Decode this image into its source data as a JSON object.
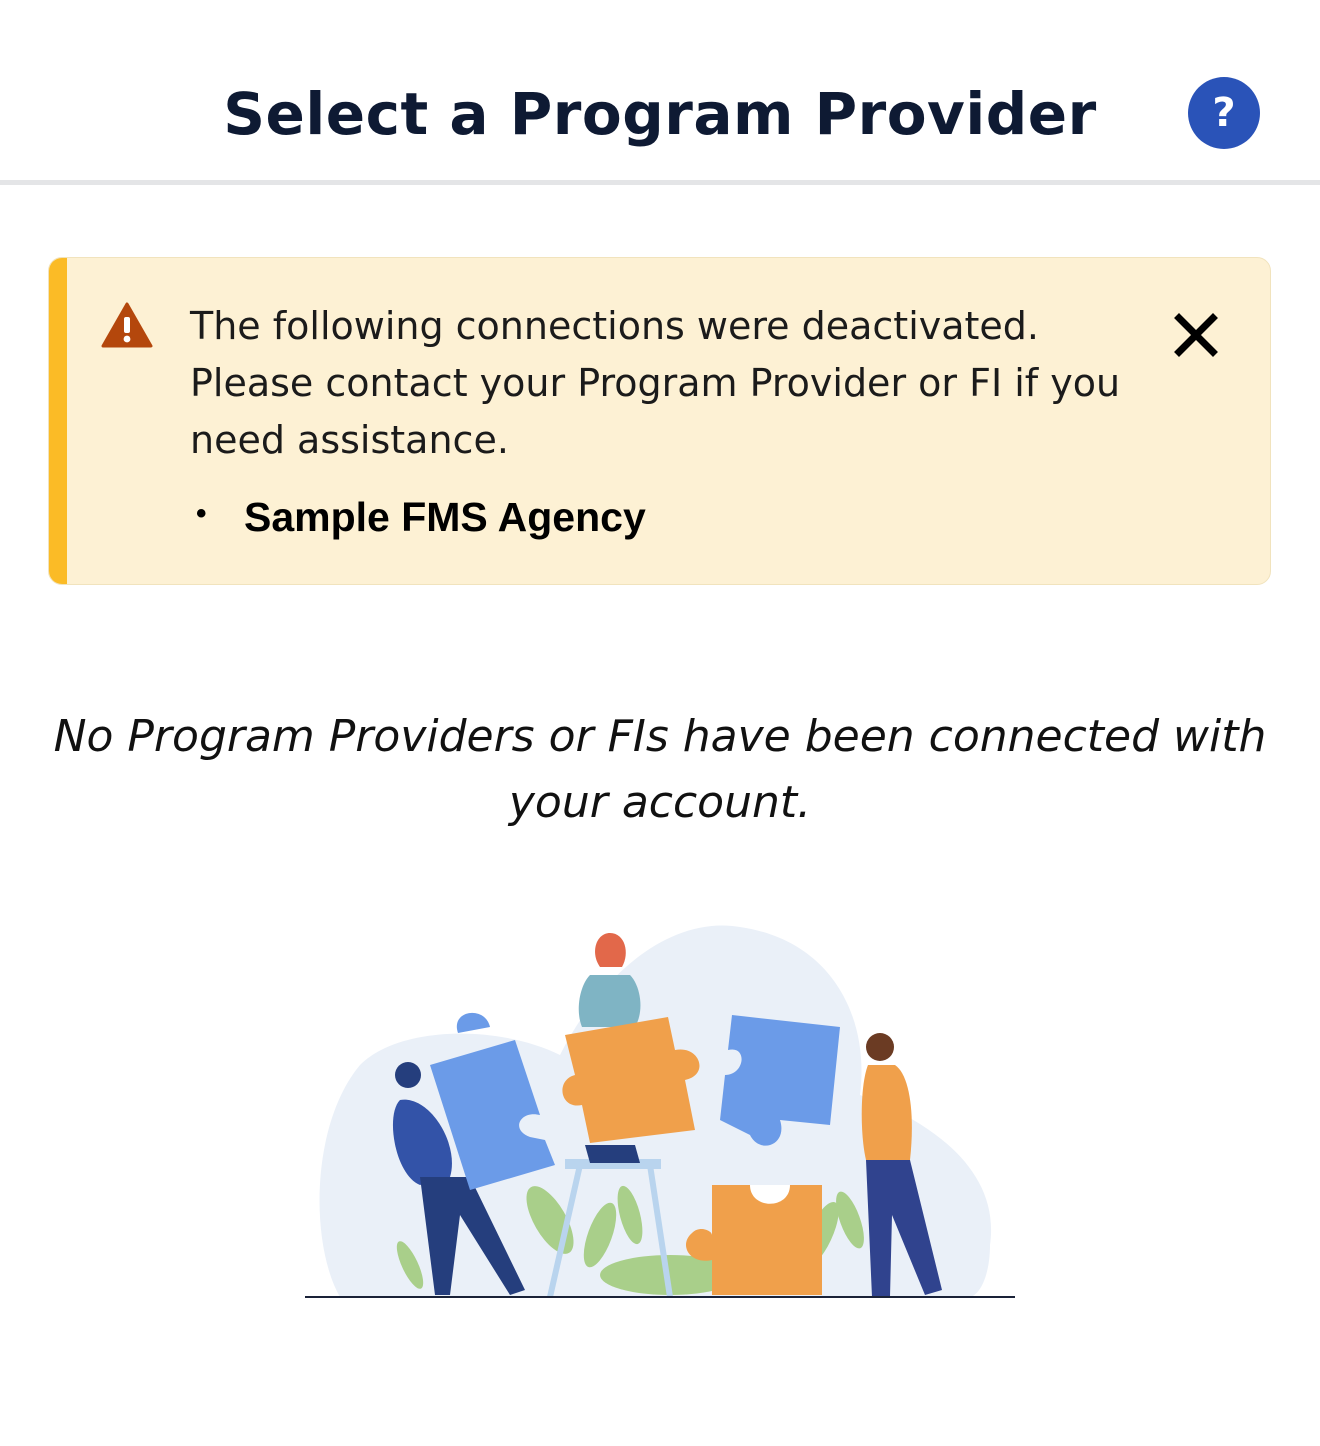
{
  "header": {
    "title": "Select a Program Provider",
    "help_label": "?"
  },
  "alert": {
    "icon": "warning-icon",
    "message": "The following connections were deactivated. Please contact your Program Provider or FI if you need assistance.",
    "items": [
      "Sample FMS Agency"
    ],
    "close_icon": "close-icon"
  },
  "empty_state": {
    "message": "No Program Providers or FIs have been connected with your account.",
    "illustration": "puzzle-teamwork-illustration"
  },
  "colors": {
    "title": "#0e1a33",
    "help_button": "#2a53b8",
    "alert_background": "#fdf1d4",
    "alert_accent": "#fbbb26",
    "warning_icon": "#b4470c"
  }
}
